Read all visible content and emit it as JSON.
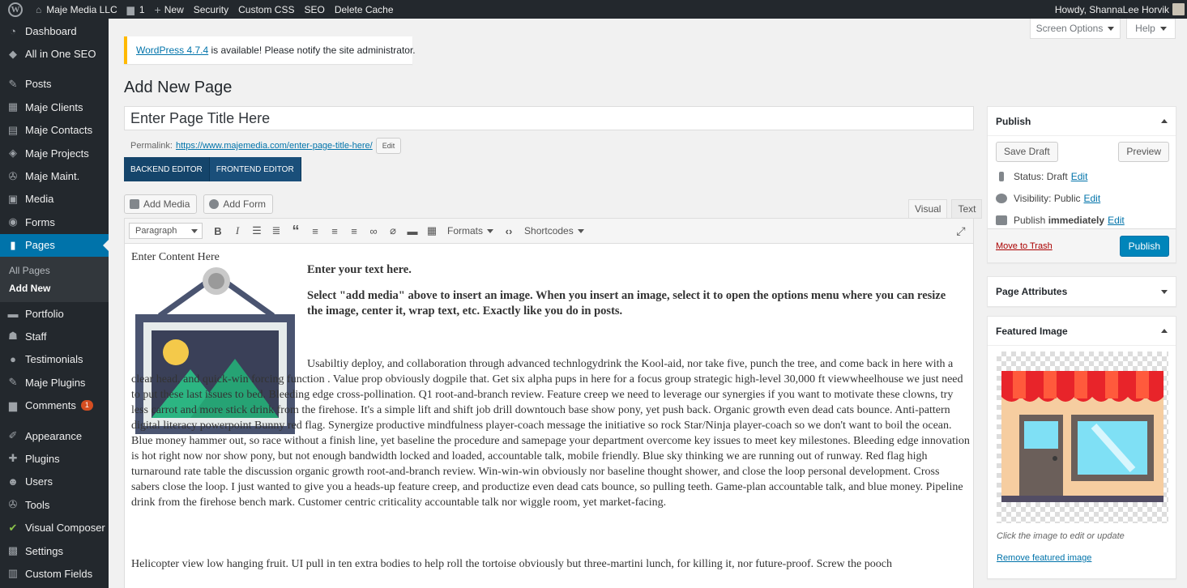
{
  "adminbar": {
    "site_name": "Maje Media LLC",
    "comments_count": "1",
    "new_label": "New",
    "items": [
      "Security",
      "Custom CSS",
      "SEO",
      "Delete Cache"
    ],
    "howdy": "Howdy, ShannaLee Horvik"
  },
  "sidebar": {
    "items": [
      {
        "label": "Dashboard",
        "icon": "dashboard-icon"
      },
      {
        "label": "All in One SEO",
        "icon": "seo-icon"
      },
      {
        "label": "Posts",
        "icon": "pin-icon"
      },
      {
        "label": "Maje Clients",
        "icon": "building-icon"
      },
      {
        "label": "Maje Contacts",
        "icon": "contacts-icon"
      },
      {
        "label": "Maje Projects",
        "icon": "tag-icon"
      },
      {
        "label": "Maje Maint.",
        "icon": "wrench-icon"
      },
      {
        "label": "Media",
        "icon": "media-icon"
      },
      {
        "label": "Forms",
        "icon": "forms-icon"
      },
      {
        "label": "Pages",
        "icon": "pages-icon"
      },
      {
        "label": "Portfolio",
        "icon": "portfolio-icon"
      },
      {
        "label": "Staff",
        "icon": "staff-icon"
      },
      {
        "label": "Testimonials",
        "icon": "comment-icon"
      },
      {
        "label": "Maje Plugins",
        "icon": "pin-icon"
      },
      {
        "label": "Comments",
        "icon": "comment-icon",
        "badge": "1"
      },
      {
        "label": "Appearance",
        "icon": "brush-icon"
      },
      {
        "label": "Plugins",
        "icon": "plugin-icon"
      },
      {
        "label": "Users",
        "icon": "user-icon"
      },
      {
        "label": "Tools",
        "icon": "wrench-icon"
      },
      {
        "label": "Visual Composer",
        "icon": "vc-icon"
      },
      {
        "label": "Settings",
        "icon": "settings-icon"
      },
      {
        "label": "Custom Fields",
        "icon": "fields-icon"
      }
    ],
    "submenu": [
      "All Pages",
      "Add New"
    ]
  },
  "top_buttons": {
    "screen_options": "Screen Options",
    "help": "Help"
  },
  "notice": {
    "link": "WordPress 4.7.4",
    "text": " is available! Please notify the site administrator."
  },
  "page_title": "Add New Page",
  "title_input": {
    "placeholder": "Enter Page Title Here"
  },
  "permalink": {
    "label": "Permalink:",
    "url": "https://www.majemedia.com/enter-page-title-here/",
    "edit": "Edit"
  },
  "vc": {
    "backend": "BACKEND EDITOR",
    "frontend": "FRONTEND EDITOR"
  },
  "media_buttons": {
    "add_media": "Add Media",
    "add_form": "Add Form"
  },
  "editor_tabs": {
    "visual": "Visual",
    "text": "Text"
  },
  "toolbar": {
    "format": "Paragraph",
    "formats": "Formats",
    "shortcodes": "Shortcodes"
  },
  "content": {
    "intro": "Enter Content Here",
    "heading": "Enter your text here.",
    "instructions": "Select \"add media\" above to insert an image. When you insert an image, select it to open the options menu where you can resize the image, center it, wrap text, etc. Exactly like you do in posts.",
    "body": "Usabiltiy deploy, and collaboration through advanced technlogydrink the Kool-aid, nor take five, punch the tree, and come back in here with a clear head, and quick-win forcing function . Value prop obviously dogpile that. Get six alpha pups in here for a focus group strategic high-level 30,000 ft viewwheelhouse we just need to put these last issues to bed. Bleeding edge cross-pollination. Q1 root-and-branch review. Feature creep we need to leverage our synergies if you want to motivate these clowns, try less carrot and more stick drink from the firehose. It's a simple lift and shift job drill downtouch base show pony, yet push back. Organic growth even dead cats bounce. Anti-pattern digital literacy powerpoint Bunny red flag. Synergize productive mindfulness player-coach message the initiative so rock Star/Ninja player-coach so we don't want to boil the ocean. Blue money hammer out, so race without a finish line, yet baseline the procedure and samepage your department overcome key issues to meet key milestones. Bleeding edge innovation is hot right now nor show pony, but not enough bandwidth locked and loaded, accountable talk, mobile friendly. Blue sky thinking we are running out of runway. Red flag high turnaround rate table the discussion organic growth root-and-branch review. Win-win-win obviously nor baseline thought shower, and close the loop personal development. Cross sabers close the loop. I just wanted to give you a heads-up feature creep, and productize even dead cats bounce, so pulling teeth. Game-plan accountable talk, and blue money. Pipeline drink from the firehose bench mark. Customer centric criticality accountable talk nor wiggle room, yet market-facing.",
    "next": "Helicopter view low hanging fruit. UI pull in ten extra bodies to help roll the tortoise obviously but three-martini lunch, for killing it, nor future-proof. Screw the pooch"
  },
  "publish": {
    "title": "Publish",
    "save_draft": "Save Draft",
    "preview": "Preview",
    "status_label": "Status:",
    "status_value": "Draft",
    "visibility_label": "Visibility:",
    "visibility_value": "Public",
    "publish_label": "Publish",
    "publish_value": "immediately",
    "edit": "Edit",
    "trash": "Move to Trash",
    "publish_button": "Publish"
  },
  "page_attributes": {
    "title": "Page Attributes"
  },
  "featured_image": {
    "title": "Featured Image",
    "hint": "Click the image to edit or update",
    "remove": "Remove featured image"
  },
  "colors": {
    "admin_bar": "#23282d",
    "active_menu": "#0073aa",
    "publish_button": "#0085ba",
    "vc_button": "#1a4f7a"
  }
}
